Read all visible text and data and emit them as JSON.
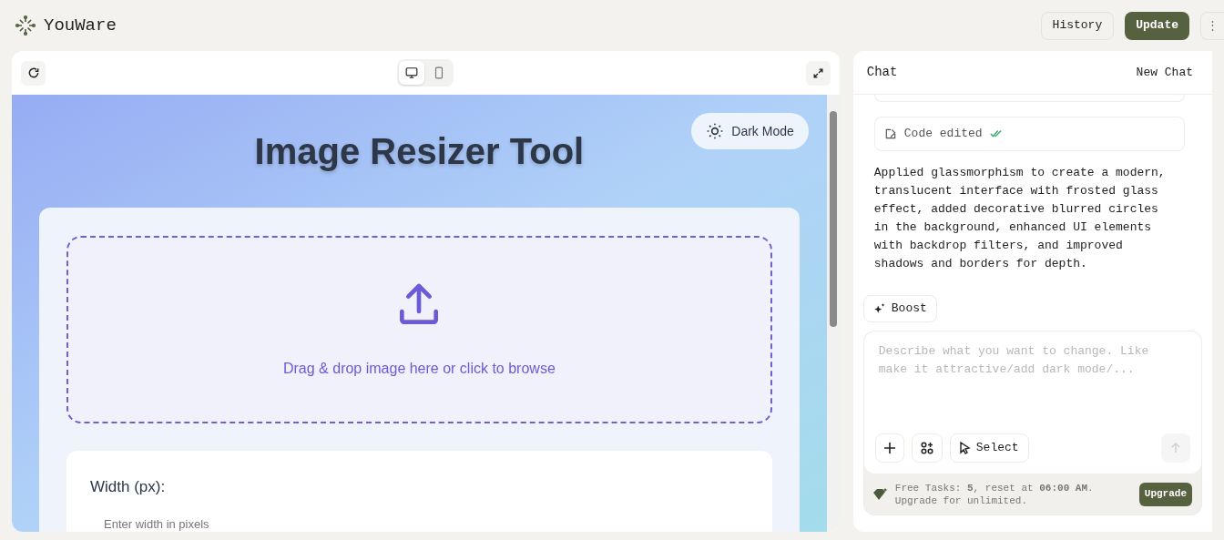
{
  "app": {
    "name": "YouWare"
  },
  "header_buttons": [
    {
      "kind": "outline",
      "label": "History"
    },
    {
      "kind": "primary",
      "label": "Update"
    },
    {
      "kind": "more",
      "label": "⋮"
    }
  ],
  "preview": {
    "devices": [
      {
        "kind": "desktop",
        "selected": true
      },
      {
        "kind": "mobile",
        "selected": false
      }
    ],
    "page": {
      "title": "Image Resizer Tool",
      "theme_toggle": "Dark Mode",
      "dropzone_text": "Drag & drop image here or click to browse",
      "width_label": "Width (px):",
      "width_placeholder": "Enter width in pixels"
    }
  },
  "chat": {
    "title": "Chat",
    "new_chat": "New Chat",
    "status": "Code edited",
    "message": "Applied glassmorphism to create a modern, translucent interface with frosted glass effect, added decorative blurred circles in the background, enhanced UI elements with backdrop filters, and improved shadows and borders for depth.",
    "boost": "Boost",
    "input_placeholder": "Describe what you want to change. Like make it attractive/add dark mode/...",
    "select": "Select",
    "quota": "Free Tasks: **5**, reset at **06:00 AM**. Upgrade for unlimited.",
    "upgrade": "Upgrade"
  }
}
